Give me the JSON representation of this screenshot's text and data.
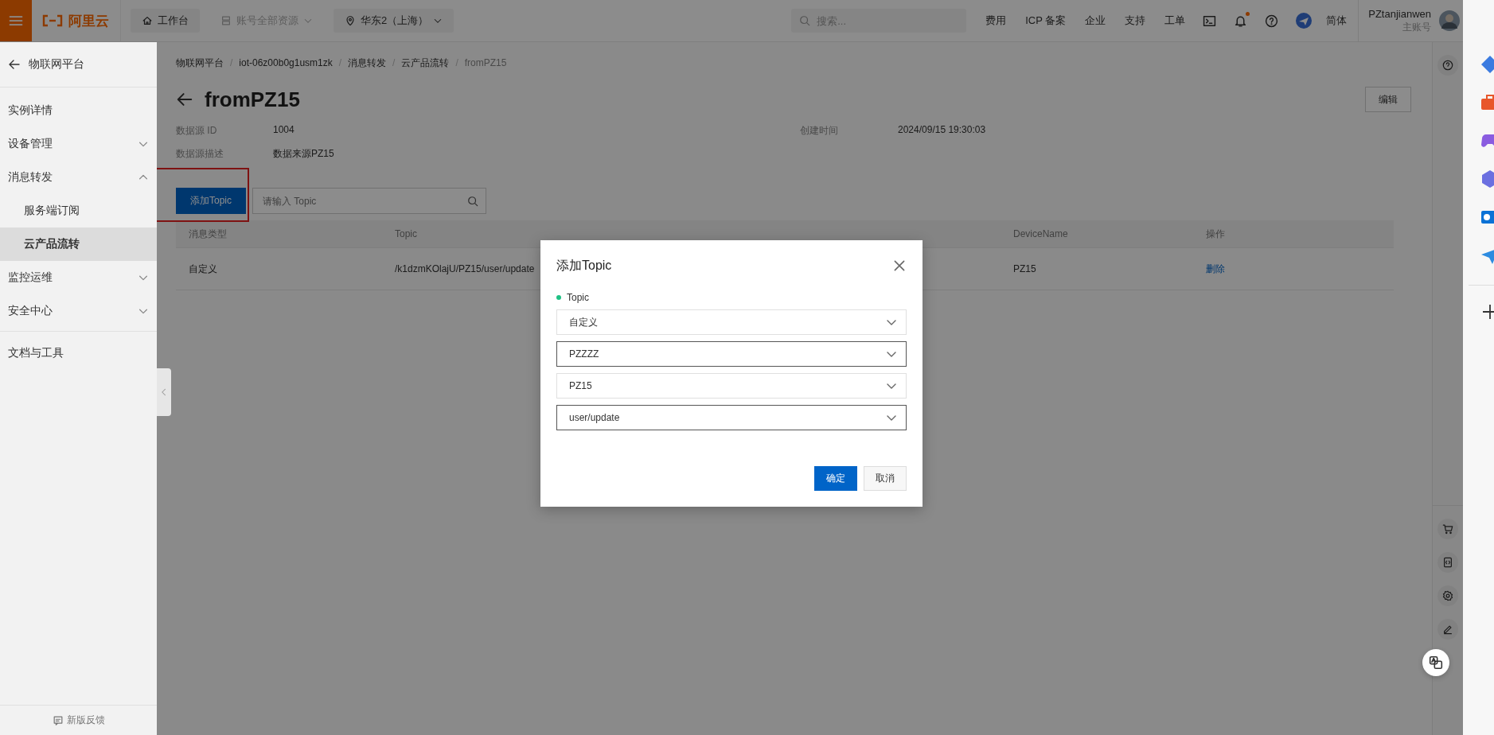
{
  "top_bar": {
    "logo": "阿里云",
    "nav": [
      {
        "kind": "home",
        "label": "工作台",
        "disabled": false
      },
      {
        "kind": "resources",
        "label": "账号全部资源",
        "disabled": true
      },
      {
        "kind": "region",
        "label": "华东2（上海）",
        "disabled": false
      }
    ],
    "search": {
      "placeholder": "搜索..."
    },
    "links": [
      "费用",
      "ICP 备案",
      "企业",
      "支持",
      "工单"
    ],
    "notifications": {
      "unread": true
    },
    "language": "简体",
    "user": {
      "name": "PZtanjianwen",
      "role": "主账号"
    }
  },
  "sidebar": {
    "back": "物联网平台",
    "items": [
      {
        "kind": "link",
        "label": "实例详情"
      },
      {
        "kind": "group",
        "label": "设备管理",
        "expanded": false
      },
      {
        "kind": "group",
        "label": "消息转发",
        "expanded": true,
        "children": [
          {
            "label": "服务端订阅",
            "selected": false
          },
          {
            "label": "云产品流转",
            "selected": true
          }
        ]
      },
      {
        "kind": "group",
        "label": "监控运维",
        "expanded": false
      },
      {
        "kind": "group",
        "label": "安全中心",
        "expanded": false
      }
    ],
    "footer_links": [
      "文档与工具"
    ],
    "feedback": "新版反馈"
  },
  "breadcrumb": {
    "items": [
      "物联网平台",
      "iot-06z00b0g1usm1zk",
      "消息转发",
      "云产品流转",
      "fromPZ15"
    ],
    "separators": [
      "/",
      "/",
      "/",
      "/"
    ]
  },
  "page": {
    "title": "fromPZ15",
    "edit_button": "编辑",
    "details": [
      {
        "label": "数据源 ID",
        "value": "1004"
      },
      {
        "label": "创建时间",
        "value": "2024/09/15 19:30:03"
      },
      {
        "label": "数据源描述",
        "value": "数据来源PZ15"
      }
    ]
  },
  "toolbar": {
    "add_button": "添加Topic",
    "highlighted": true,
    "search": {
      "placeholder": "请输入 Topic"
    }
  },
  "table": {
    "columns": {
      "type": "消息类型",
      "topic": "Topic",
      "device_name": "DeviceName",
      "action": "操作"
    },
    "rows": [
      {
        "type": "自定义",
        "topic": "/k1dzmKOlajU/PZ15/user/update",
        "device_name": "PZ15",
        "action": "删除"
      }
    ]
  },
  "dialog": {
    "title": "添加Topic",
    "field_label": "Topic",
    "selects": [
      {
        "value": "自定义",
        "focused": false
      },
      {
        "value": "PZZZZ",
        "focused": true
      },
      {
        "value": "PZ15",
        "focused": false
      },
      {
        "value": "user/update",
        "focused": true
      }
    ],
    "buttons": [
      {
        "kind": "primary",
        "label": "确定"
      },
      {
        "kind": "secondary",
        "label": "取消"
      }
    ]
  }
}
